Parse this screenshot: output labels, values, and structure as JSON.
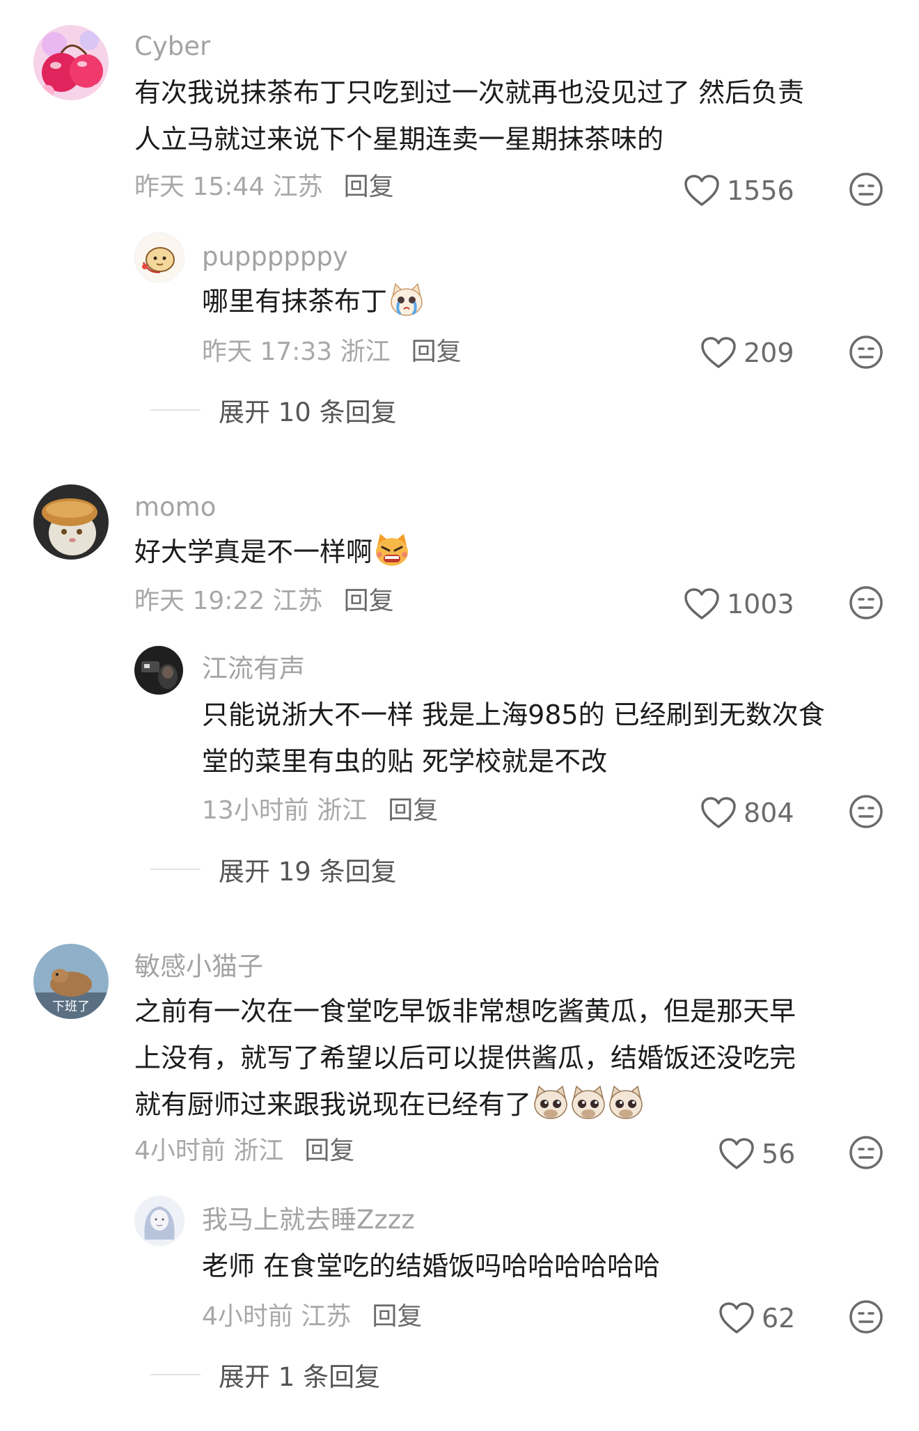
{
  "comments": [
    {
      "user": "Cyber",
      "lines": [
        "有次我说抹茶布丁只吃到过一次就再也没见过了 然后负责",
        "人立马就过来说下个星期连卖一星期抹茶味的"
      ],
      "time": "昨天 15:44 江苏",
      "reply_label": "回复",
      "likes": "1556",
      "avatar_icon": "cherry-avatar",
      "replies": [
        {
          "user": "puppppppy",
          "lines": [
            "哪里有抹茶布丁"
          ],
          "emoji": [
            "crying-cat-emoji"
          ],
          "time": "昨天 17:33 浙江",
          "reply_label": "回复",
          "likes": "209",
          "avatar_icon": "cartoon-dog-avatar"
        }
      ],
      "expand": "展开 10 条回复"
    },
    {
      "user": "momo",
      "lines": [
        "好大学真是不一样啊"
      ],
      "emoji": [
        "angry-cat-emoji"
      ],
      "time": "昨天 19:22 江苏",
      "reply_label": "回复",
      "likes": "1003",
      "avatar_icon": "cat-bread-avatar",
      "replies": [
        {
          "user": "江流有声",
          "lines": [
            "只能说浙大不一样 我是上海985的 已经刷到无数次食",
            "堂的菜里有虫的贴 死学校就是不改"
          ],
          "time": "13小时前 浙江",
          "reply_label": "回复",
          "likes": "804",
          "avatar_icon": "dark-photo-avatar"
        }
      ],
      "expand": "展开 19 条回复"
    },
    {
      "user": "敏感小猫子",
      "lines": [
        "之前有一次在一食堂吃早饭非常想吃酱黄瓜，但是那天早",
        "上没有，就写了希望以后可以提供酱瓜，结婚饭还没吃完",
        "就有厨师过来跟我说现在已经有了"
      ],
      "emoji": [
        "pleading-cat-emoji",
        "pleading-cat-emoji",
        "pleading-cat-emoji"
      ],
      "time": "4小时前 浙江",
      "reply_label": "回复",
      "likes": "56",
      "avatar_icon": "capybara-avatar",
      "avatar_text": "下班了",
      "replies": [
        {
          "user": "我马上就去睡Zzzz",
          "lines": [
            "老师 在食堂吃的结婚饭吗哈哈哈哈哈哈"
          ],
          "time": "4小时前 江苏",
          "reply_label": "回复",
          "likes": "62",
          "avatar_icon": "sketch-girl-avatar"
        }
      ],
      "expand": "展开 1 条回复"
    }
  ],
  "colors": {
    "name": "#a3a3a3",
    "text": "#1b1b1b",
    "meta": "#a8a8a8",
    "action": "#6b6b6b"
  }
}
